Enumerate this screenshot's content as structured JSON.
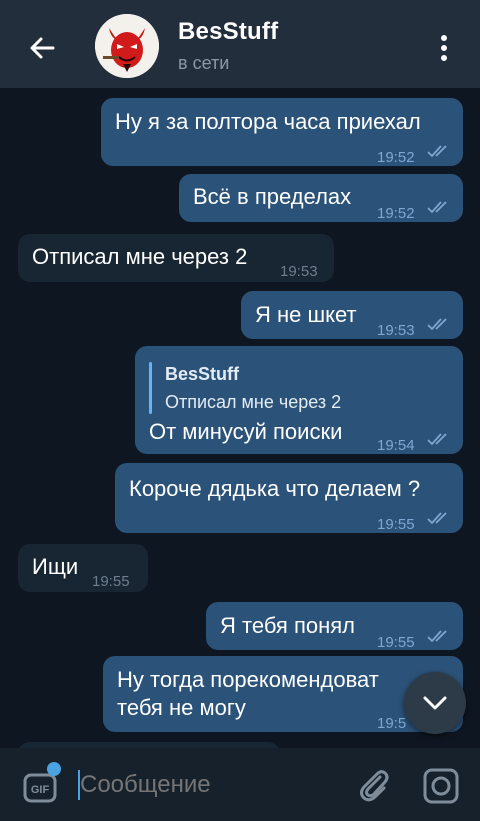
{
  "header": {
    "back_icon": "arrow-left-icon",
    "title": "BesStuff",
    "status": "в сети",
    "avatar_icon": "devil-avatar",
    "menu_icon": "more-vertical-icon"
  },
  "messages": [
    {
      "dir": "out",
      "text": "Ну я за полтора часа приехал",
      "time": "19:52",
      "read": true
    },
    {
      "dir": "out",
      "text": "Всё в пределах",
      "time": "19:52",
      "read": true
    },
    {
      "dir": "in",
      "text": "Отписал мне через 2",
      "time": "19:53"
    },
    {
      "dir": "out",
      "text": "Я не шкет",
      "time": "19:53",
      "read": true
    },
    {
      "dir": "out",
      "reply_name": "BesStuff",
      "reply_text": "Отписал мне через 2",
      "text": "От минусуй поиски",
      "time": "19:54",
      "read": true
    },
    {
      "dir": "out",
      "text": "Короче дядька что делаем ?",
      "time": "19:55",
      "read": true
    },
    {
      "dir": "in",
      "text": "Ищи",
      "time": "19:55"
    },
    {
      "dir": "out",
      "text": "Я тебя понял",
      "time": "19:55",
      "read": true
    },
    {
      "dir": "out",
      "text_line1": "Ну тогда порекомендоват",
      "text_line2": "тебя не могу",
      "time": "19:5"
    }
  ],
  "input": {
    "placeholder": "Сообщение",
    "gif_label": "GIF",
    "attach_icon": "paperclip-icon",
    "camera_icon": "camera-icon"
  },
  "scroll_down_icon": "chevron-down-icon",
  "colors": {
    "background": "#0e1621",
    "header": "#232e3c",
    "outgoing_bubble": "#2b5278",
    "incoming_bubble": "#182533",
    "accent": "#4ba3e3"
  }
}
